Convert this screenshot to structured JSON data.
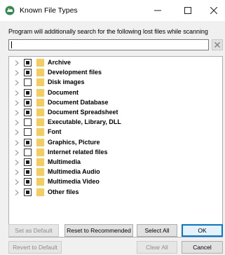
{
  "window": {
    "title": "Known File Types",
    "controls": {
      "minimize": "–",
      "maximize": "☐",
      "close": "✕"
    }
  },
  "instruction": "Program will additionally search for the following lost files while scanning",
  "search": {
    "value": "",
    "clear_icon": "clear-icon"
  },
  "file_types": [
    {
      "label": "Archive",
      "checked": "indeterminate"
    },
    {
      "label": "Development files",
      "checked": "indeterminate"
    },
    {
      "label": "Disk images",
      "checked": "unchecked"
    },
    {
      "label": "Document",
      "checked": "indeterminate"
    },
    {
      "label": "Document Database",
      "checked": "indeterminate"
    },
    {
      "label": "Document Spreadsheet",
      "checked": "indeterminate"
    },
    {
      "label": "Executable, Library, DLL",
      "checked": "unchecked"
    },
    {
      "label": "Font",
      "checked": "unchecked"
    },
    {
      "label": "Graphics, Picture",
      "checked": "indeterminate"
    },
    {
      "label": "Internet related files",
      "checked": "unchecked"
    },
    {
      "label": "Multimedia",
      "checked": "indeterminate"
    },
    {
      "label": "Multimedia Audio",
      "checked": "indeterminate"
    },
    {
      "label": "Multimedia Video",
      "checked": "indeterminate"
    },
    {
      "label": "Other files",
      "checked": "indeterminate"
    }
  ],
  "buttons": {
    "set_as_default": "Set as Default",
    "reset_to_recommended": "Reset to Recommended",
    "select_all": "Select All",
    "ok": "OK",
    "revert_to_default": "Revert to Default",
    "clear_all": "Clear All",
    "cancel": "Cancel"
  },
  "colors": {
    "folder": "#f5cd5e",
    "accent": "#0078d7",
    "app_icon": "#2e8b57"
  }
}
